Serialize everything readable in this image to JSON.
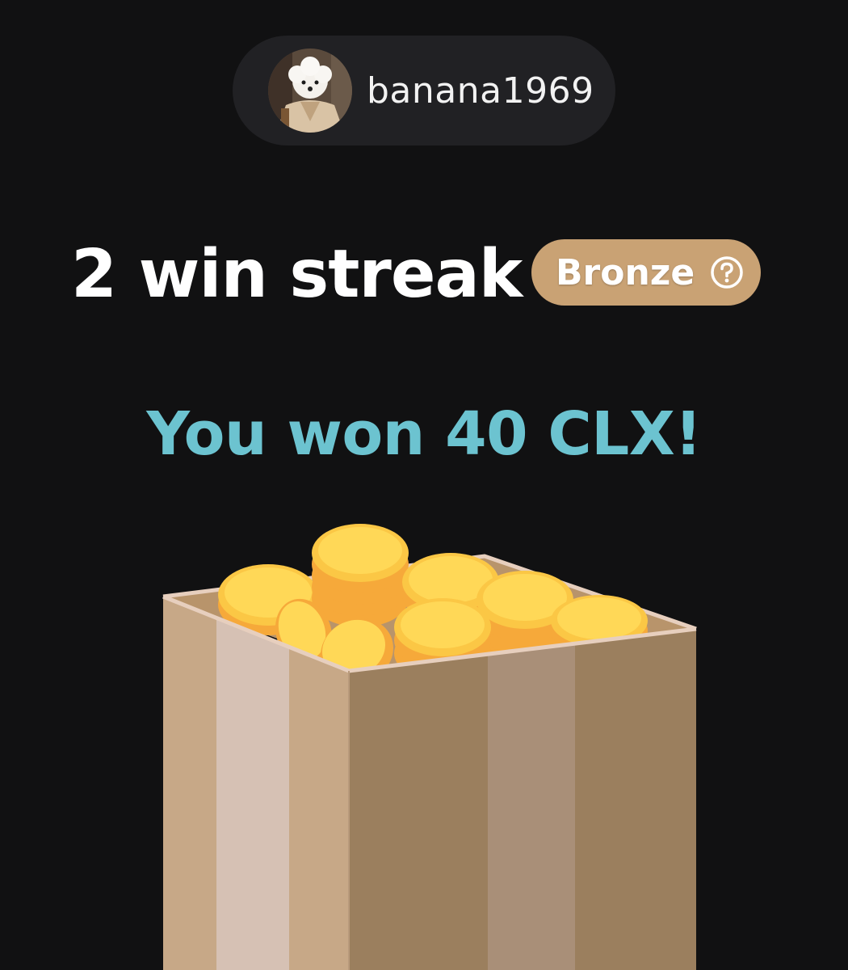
{
  "user": {
    "username": "banana1969",
    "avatar_icon": "avatar-dog-photo"
  },
  "streak": {
    "title": "2 win streak",
    "tier_label": "Bronze",
    "tier_color": "#c9a274",
    "help_icon": "question-circle-icon"
  },
  "reward": {
    "message": "You won 40 CLX!",
    "message_color": "#6cc3d0",
    "illustration": "coin-box-icon"
  },
  "theme": {
    "background": "#111112",
    "chip_background": "#212124"
  }
}
